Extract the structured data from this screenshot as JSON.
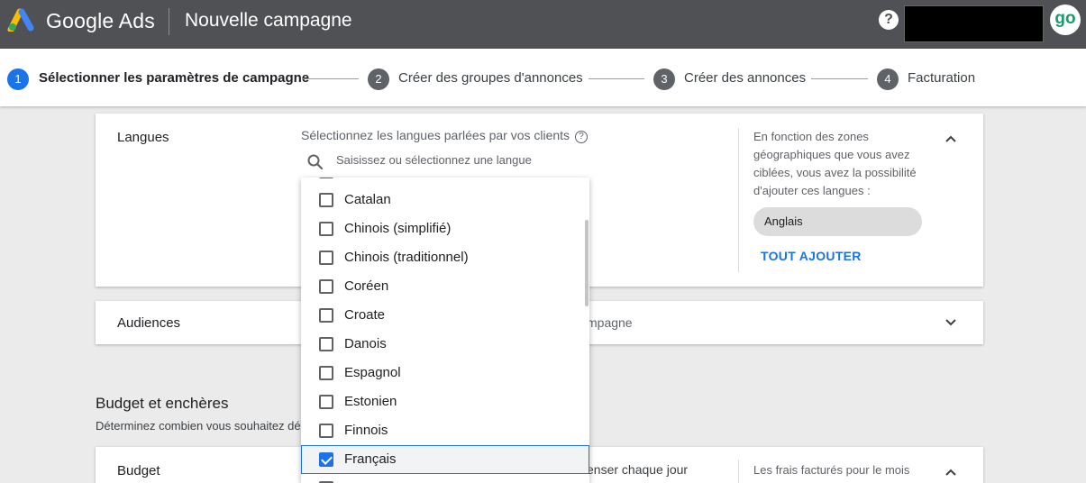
{
  "header": {
    "brand": "Google Ads",
    "page_title": "Nouvelle campagne",
    "help_icon": "help-circle-icon",
    "avatar_text": "go"
  },
  "stepper": [
    {
      "number": "1",
      "label": "Sélectionner les paramètres de campagne",
      "active": true
    },
    {
      "number": "2",
      "label": "Créer des groupes d'annonces",
      "active": false
    },
    {
      "number": "3",
      "label": "Créer des annonces",
      "active": false
    },
    {
      "number": "4",
      "label": "Facturation",
      "active": false
    }
  ],
  "languages": {
    "title": "Langues",
    "prompt": "Sélectionnez les langues parlées par vos clients",
    "search_placeholder": "Saisissez ou sélectionnez une langue",
    "side_text": "En fonction des zones géographiques que vous avez ciblées, vous avez la possibilité d'ajouter ces langues :",
    "suggested_chip": "Anglais",
    "add_all": "TOUT AJOUTER"
  },
  "audiences": {
    "title": "Audiences",
    "partial_text": "mpagne"
  },
  "budget_section": {
    "title": "Budget et enchères",
    "subtitle": "Déterminez combien vous souhaitez dé"
  },
  "budget": {
    "title": "Budget",
    "partial_text": "enser chaque jour",
    "side_text": "Les frais facturés pour le mois"
  },
  "dropdown_items": [
    {
      "label": "Catalan",
      "checked": false
    },
    {
      "label": "Chinois (simplifié)",
      "checked": false
    },
    {
      "label": "Chinois (traditionnel)",
      "checked": false
    },
    {
      "label": "Coréen",
      "checked": false
    },
    {
      "label": "Croate",
      "checked": false
    },
    {
      "label": "Danois",
      "checked": false
    },
    {
      "label": "Espagnol",
      "checked": false
    },
    {
      "label": "Estonien",
      "checked": false
    },
    {
      "label": "Finnois",
      "checked": false
    },
    {
      "label": "Français",
      "checked": true
    }
  ],
  "colors": {
    "topbar": "#4f5155",
    "accent": "#1a73e8",
    "background": "#ebebeb"
  }
}
